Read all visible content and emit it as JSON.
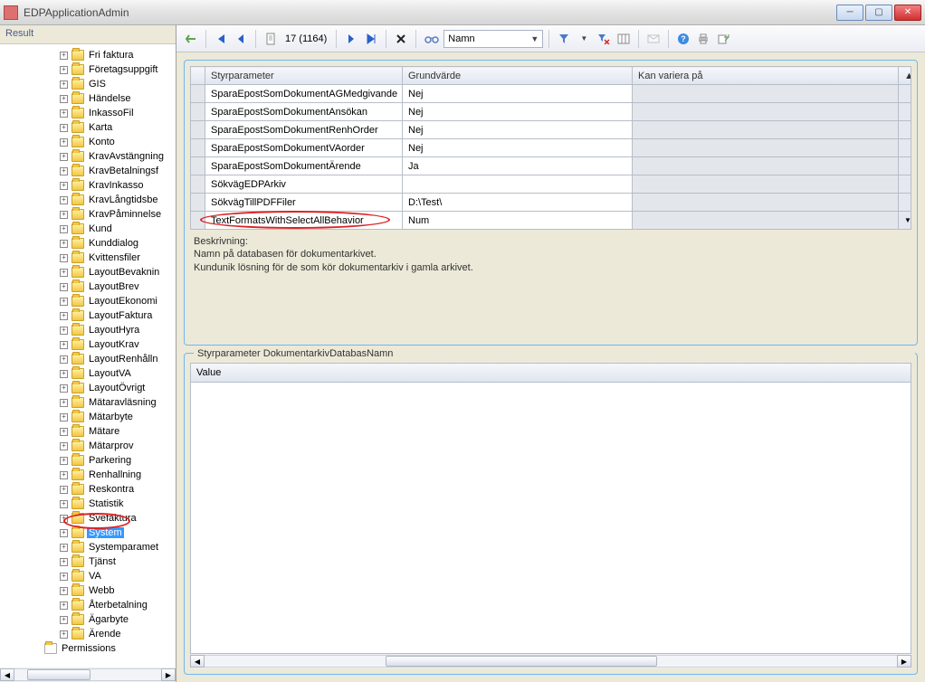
{
  "app_title": "EDPApplicationAdmin",
  "sidebar": {
    "header": "Result",
    "permissions_label": "Permissions",
    "items": [
      {
        "label": "Fri faktura"
      },
      {
        "label": "Företagsuppgift"
      },
      {
        "label": "GIS"
      },
      {
        "label": "Händelse"
      },
      {
        "label": "InkassoFil"
      },
      {
        "label": "Karta"
      },
      {
        "label": "Konto"
      },
      {
        "label": "KravAvstängning"
      },
      {
        "label": "KravBetalningsf"
      },
      {
        "label": "KravInkasso"
      },
      {
        "label": "KravLångtidsbe"
      },
      {
        "label": "KravPåminnelse"
      },
      {
        "label": "Kund"
      },
      {
        "label": "Kunddialog"
      },
      {
        "label": "Kvittensfiler"
      },
      {
        "label": "LayoutBevaknin"
      },
      {
        "label": "LayoutBrev"
      },
      {
        "label": "LayoutEkonomi"
      },
      {
        "label": "LayoutFaktura"
      },
      {
        "label": "LayoutHyra"
      },
      {
        "label": "LayoutKrav"
      },
      {
        "label": "LayoutRenhålln"
      },
      {
        "label": "LayoutVA"
      },
      {
        "label": "LayoutÖvrigt"
      },
      {
        "label": "Mätaravläsning"
      },
      {
        "label": "Mätarbyte"
      },
      {
        "label": "Mätare"
      },
      {
        "label": "Mätarprov"
      },
      {
        "label": "Parkering"
      },
      {
        "label": "Renhallning"
      },
      {
        "label": "Reskontra"
      },
      {
        "label": "Statistik"
      },
      {
        "label": "Svefaktura"
      },
      {
        "label": "System",
        "selected": true
      },
      {
        "label": "Systemparamet"
      },
      {
        "label": "Tjänst"
      },
      {
        "label": "VA"
      },
      {
        "label": "Webb"
      },
      {
        "label": "Återbetalning"
      },
      {
        "label": "Ägarbyte"
      },
      {
        "label": "Ärende"
      }
    ]
  },
  "toolbar": {
    "page_counter": "17 (1164)",
    "filter_dropdown": "Namn"
  },
  "grid": {
    "headers": [
      "Styrparameter",
      "Grundvärde",
      "Kan variera på"
    ],
    "rows": [
      {
        "p": "SparaEpostSomDokumentAGMedgivande",
        "g": "Nej",
        "k": ""
      },
      {
        "p": "SparaEpostSomDokumentAnsökan",
        "g": "Nej",
        "k": ""
      },
      {
        "p": "SparaEpostSomDokumentRenhOrder",
        "g": "Nej",
        "k": ""
      },
      {
        "p": "SparaEpostSomDokumentVAorder",
        "g": "Nej",
        "k": ""
      },
      {
        "p": "SparaEpostSomDokumentÄrende",
        "g": "Ja",
        "k": ""
      },
      {
        "p": "SökvägEDPArkiv",
        "g": "",
        "k": ""
      },
      {
        "p": "SökvägTillPDFFiler",
        "g": "D:\\Test\\",
        "k": ""
      },
      {
        "p": "TextFormatsWithSelectAllBehavior",
        "g": "Num",
        "k": "",
        "highlight": true
      }
    ]
  },
  "description": {
    "label": "Beskrivning:",
    "line1": "Namn på databasen för dokumentarkivet.",
    "line2": "Kundunik lösning för de som kör dokumentarkiv i gamla arkivet."
  },
  "bottom_panel": {
    "legend": "Styrparameter DokumentarkivDatabasNamn",
    "value_header": "Value"
  }
}
